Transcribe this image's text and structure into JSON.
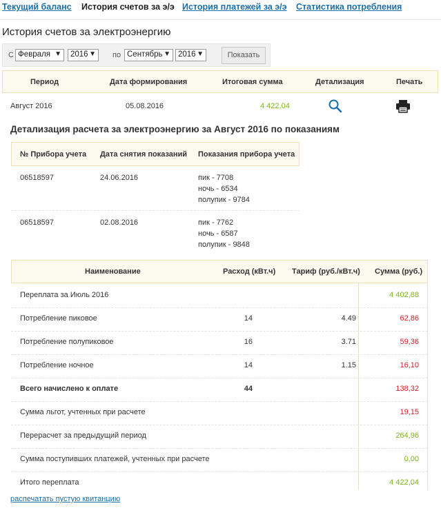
{
  "tabs": [
    {
      "label": "Текущий баланс"
    },
    {
      "label": "История счетов за э/э"
    },
    {
      "label": "История платежей за э/э"
    },
    {
      "label": "Статистика потребления"
    }
  ],
  "page_title": "История счетов за электроэнергию",
  "filter": {
    "from_label": "С",
    "from_month": "Февраля",
    "from_year": "2016",
    "to_label": "по",
    "to_month": "Сентябрь",
    "to_year": "2016",
    "show_button": "Показать"
  },
  "bills_table": {
    "headers": [
      "Период",
      "Дата формирования",
      "Итоговая сумма",
      "Детализация",
      "Печать"
    ],
    "rows": [
      {
        "period": "Август 2016",
        "date": "05.08.2016",
        "total": "4 422,04",
        "detail_icon": "search-icon",
        "print_icon": "printer-icon"
      }
    ]
  },
  "detail_title": "Детализация расчета за электроэнергию за Август 2016 по показаниям",
  "meter_table": {
    "headers": [
      "№ Прибора учета",
      "Дата снятия показаний",
      "Показания прибора учета"
    ],
    "rows": [
      {
        "meter": "06518597",
        "date": "24.06.2016",
        "readings": [
          "пик - 7708",
          "ночь - 6534",
          "полупик - 9784"
        ]
      },
      {
        "meter": "06518597",
        "date": "02.08.2016",
        "readings": [
          "пик - 7762",
          "ночь - 6587",
          "полупик - 9848"
        ]
      }
    ]
  },
  "calc_table": {
    "headers": [
      "Наименование",
      "Расход (кВт.ч)",
      "Тариф (руб./кВт.ч)",
      "Сумма (руб.)"
    ],
    "rows": [
      {
        "name": "Переплата за Июль 2016",
        "usage": "",
        "tariff": "",
        "sum": "4 402,88",
        "color": "green",
        "bold": false
      },
      {
        "name": "Потребление пиковое",
        "usage": "14",
        "tariff": "4.49",
        "sum": "62,86",
        "color": "red",
        "bold": false
      },
      {
        "name": "Потребление полупиковое",
        "usage": "16",
        "tariff": "3.71",
        "sum": "59,36",
        "color": "red",
        "bold": false
      },
      {
        "name": "Потребление ночное",
        "usage": "14",
        "tariff": "1.15",
        "sum": "16,10",
        "color": "red",
        "bold": false
      },
      {
        "name": "Всего начислено к оплате",
        "usage": "44",
        "tariff": "",
        "sum": "138,32",
        "color": "red",
        "bold": true
      },
      {
        "name": "Сумма льгот, учтенных при расчете",
        "usage": "",
        "tariff": "",
        "sum": "19,15",
        "color": "red",
        "bold": false
      },
      {
        "name": "Перерасчет за предыдущий период",
        "usage": "",
        "tariff": "",
        "sum": "264,96",
        "color": "green",
        "bold": false
      },
      {
        "name": "Сумма поступивших платежей, учтенных при расчете",
        "usage": "",
        "tariff": "",
        "sum": "0,00",
        "color": "green",
        "bold": false
      },
      {
        "name": "Итого переплата",
        "usage": "",
        "tariff": "",
        "sum": "4 422,04",
        "color": "green",
        "bold": false
      }
    ]
  },
  "print_empty_link": "распечатать пустую квитанцию",
  "colors": {
    "link": "#1a6fa8",
    "positive": "#7cb518",
    "negative": "#d2232a",
    "header_bg": "#fdfaef"
  }
}
